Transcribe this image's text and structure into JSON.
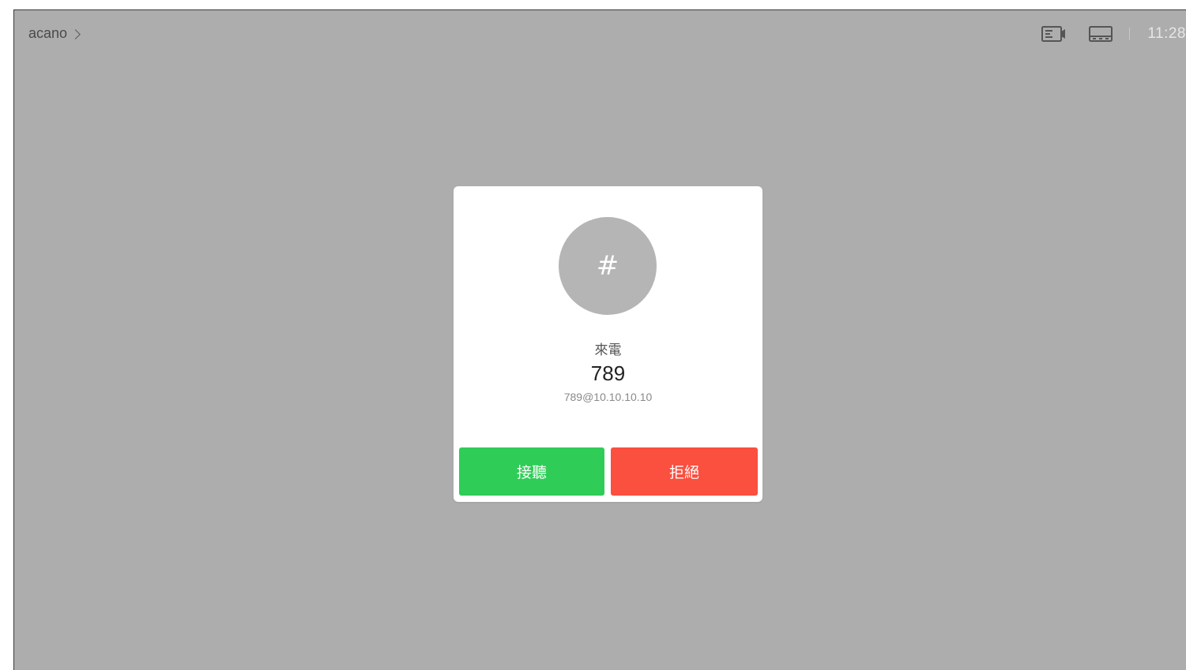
{
  "topbar": {
    "breadcrumb_label": "acano",
    "clock": "11:28",
    "icons": [
      "self-view-icon",
      "layout-icon"
    ]
  },
  "incoming_call": {
    "avatar_symbol": "#",
    "label": "來電",
    "caller_name": "789",
    "caller_uri": "789@10.10.10.10",
    "accept_label": "接聽",
    "decline_label": "拒絕"
  },
  "colors": {
    "background": "#adadad",
    "accept": "#2fcd58",
    "decline": "#fb4f3f",
    "avatar": "#b5b5b5"
  }
}
